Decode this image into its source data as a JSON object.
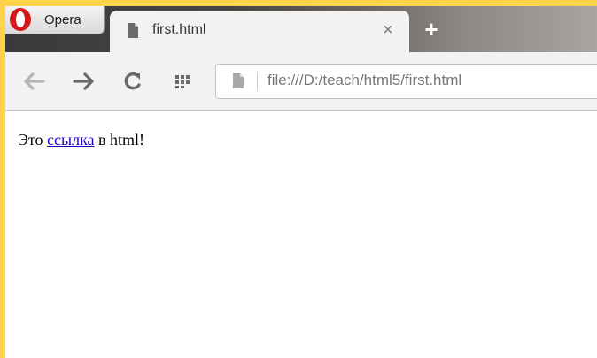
{
  "browser": {
    "menu_label": "Opera",
    "tab": {
      "title": "first.html",
      "close_glyph": "×",
      "favicon": "page-icon"
    },
    "newtab_glyph": "+",
    "address": {
      "url": "file:///D:/teach/html5/first.html",
      "icon": "page-icon"
    },
    "nav_icons": [
      "back-arrow-icon",
      "forward-arrow-icon",
      "reload-icon",
      "speed-dial-icon"
    ]
  },
  "page": {
    "before_link": "Это ",
    "link_text": "ссылка",
    "after_link": " в html!"
  },
  "colors": {
    "frame_background": "#ffd24a",
    "link": "#2200cc"
  }
}
